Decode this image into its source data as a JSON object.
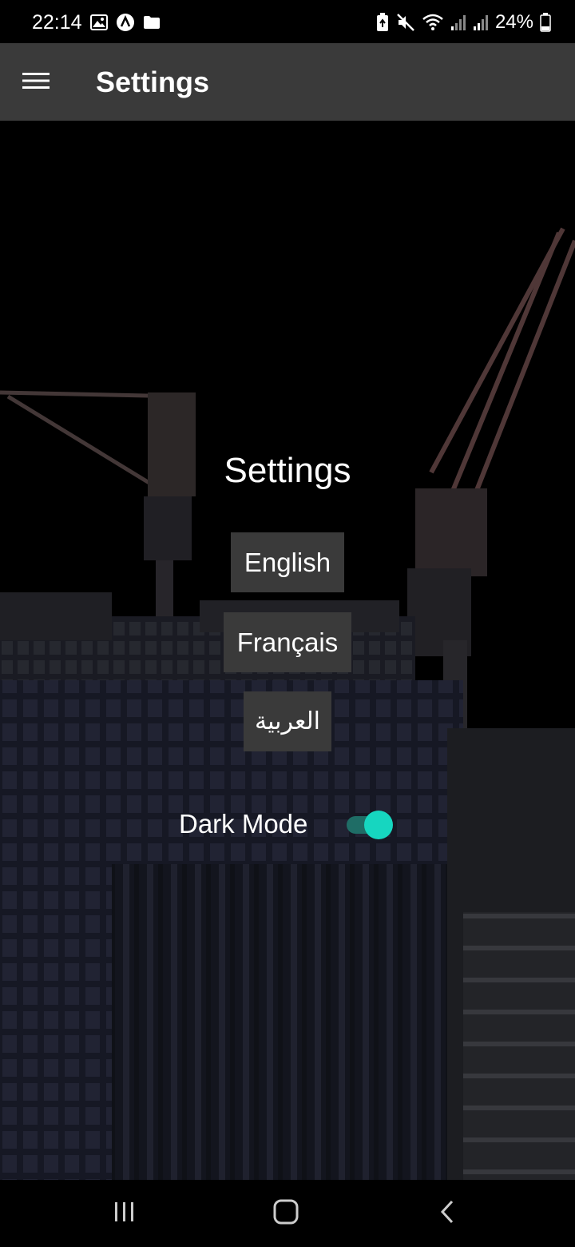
{
  "status_bar": {
    "time": "22:14",
    "battery_percent": "24%",
    "left_icons": [
      "gallery-icon",
      "app-a-icon",
      "folder-icon"
    ],
    "right_icons": [
      "battery-saver-icon",
      "mute-icon",
      "wifi-icon",
      "signal-icon",
      "signal-icon-2",
      "battery-icon"
    ]
  },
  "app_bar": {
    "title": "Settings",
    "menu_icon": "hamburger-menu-icon"
  },
  "main": {
    "heading": "Settings",
    "languages": [
      {
        "label": "English"
      },
      {
        "label": "Français"
      },
      {
        "label": "العربية"
      }
    ],
    "dark_mode": {
      "label": "Dark Mode",
      "enabled": true
    },
    "background": "construction-cranes-image"
  },
  "colors": {
    "app_bar_bg": "#3a3a3a",
    "button_bg": "#3a3a3a",
    "toggle_thumb": "#16d6c0",
    "toggle_track": "#1f6d66",
    "page_bg": "#000000"
  },
  "nav_bar": {
    "icons": [
      "recents-icon",
      "home-icon",
      "back-icon"
    ]
  }
}
